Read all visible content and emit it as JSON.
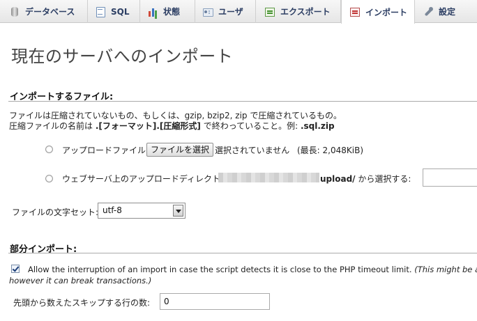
{
  "tabs": [
    {
      "label": "データベース",
      "icon": "database-icon"
    },
    {
      "label": "SQL",
      "icon": "sql-icon"
    },
    {
      "label": "状態",
      "icon": "status-icon"
    },
    {
      "label": "ユーザ",
      "icon": "users-icon"
    },
    {
      "label": "エクスポート",
      "icon": "export-icon"
    },
    {
      "label": "インポート",
      "icon": "import-icon",
      "active": true
    },
    {
      "label": "設定",
      "icon": "settings-icon"
    }
  ],
  "page_title": "現在のサーバへのインポート",
  "file_section": {
    "legend": "インポートするファイル:",
    "help_line1": "ファイルは圧縮されていないもの、もしくは、gzip, bzip2, zip で圧縮されているもの。",
    "help_line2_prefix": "圧縮ファイルの名前は ",
    "help_line2_format": ".[フォーマット].[圧縮形式]",
    "help_line2_mid": " で終わっていること。例: ",
    "help_line2_example": ".sql.zip",
    "upload_label": "アップロードファイル:",
    "choose_file_button": "ファイルを選択",
    "no_file_selected": "選択されていません",
    "max_size": "(最長: 2,048KiB)",
    "webserver_dir_label": "ウェブサーバ上のアップロードディレクトリ",
    "upload_dir_suffix": "upload/",
    "select_from": " から選択する:",
    "charset_label": "ファイルの文字セット:",
    "charset_value": "utf-8"
  },
  "partial_section": {
    "legend": "部分インポート:",
    "allow_interrupt_text": "Allow the interruption of an import in case the script detects it is close to the PHP timeout limit. ",
    "allow_interrupt_note": "(This might be a",
    "allow_interrupt_note2": "however it can break transactions.)",
    "allow_interrupt_checked": true,
    "skip_label": "先頭から数えたスキップする行の数:",
    "skip_value": "0"
  }
}
